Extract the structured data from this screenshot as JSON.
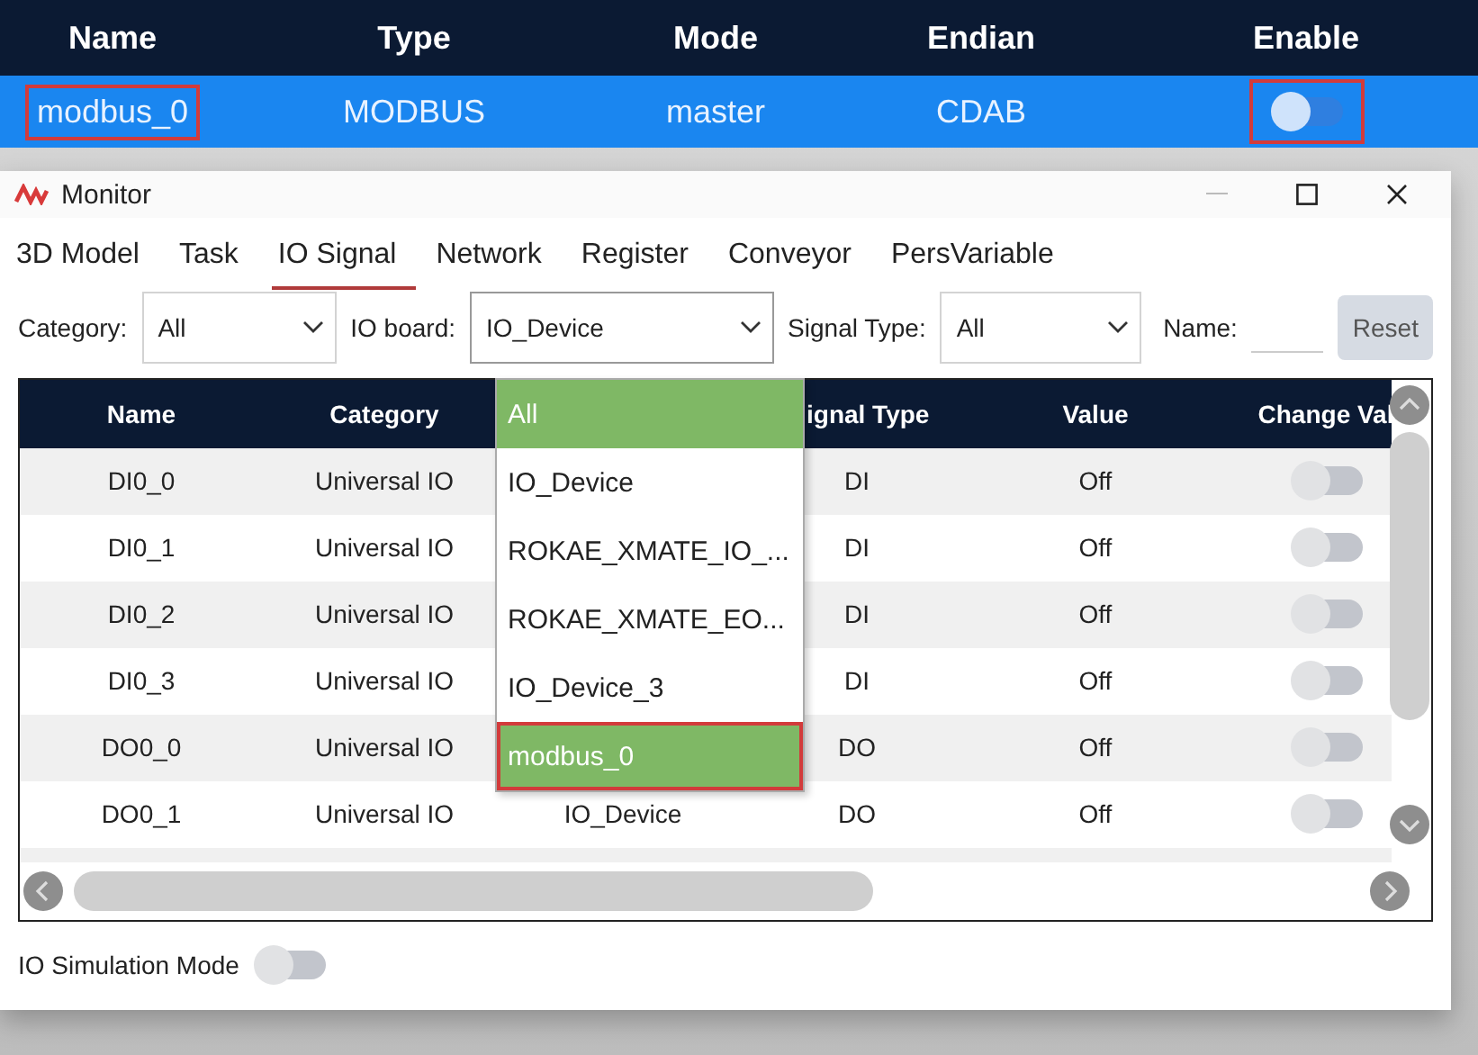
{
  "device_table": {
    "columns": [
      "Name",
      "Type",
      "Mode",
      "Endian",
      "Enable"
    ],
    "rows": [
      {
        "name": "modbus_0",
        "type": "MODBUS",
        "mode": "master",
        "endian": "CDAB",
        "enabled": false,
        "selected": true,
        "annotated": true
      }
    ]
  },
  "window": {
    "title": "Monitor"
  },
  "tabs": [
    {
      "label": "3D Model",
      "selected": false
    },
    {
      "label": "Task",
      "selected": false
    },
    {
      "label": "IO Signal",
      "selected": true
    },
    {
      "label": "Network",
      "selected": false
    },
    {
      "label": "Register",
      "selected": false
    },
    {
      "label": "Conveyor",
      "selected": false
    },
    {
      "label": "PersVariable",
      "selected": false
    }
  ],
  "filters": {
    "category": {
      "label": "Category:",
      "value": "All"
    },
    "io_board": {
      "label": "IO board:",
      "value": "IO_Device",
      "expanded": true,
      "options": [
        {
          "label": "All",
          "highlighted": true,
          "annotated": false
        },
        {
          "label": "IO_Device",
          "highlighted": false,
          "annotated": false
        },
        {
          "label": "ROKAE_XMATE_IO_...",
          "highlighted": false,
          "annotated": false
        },
        {
          "label": "ROKAE_XMATE_EO...",
          "highlighted": false,
          "annotated": false
        },
        {
          "label": "IO_Device_3",
          "highlighted": false,
          "annotated": false
        },
        {
          "label": "modbus_0",
          "highlighted": true,
          "annotated": true
        }
      ]
    },
    "signal_type": {
      "label": "Signal Type:",
      "value": "All"
    },
    "name": {
      "label": "Name:"
    },
    "reset_button": "Reset"
  },
  "signal_table": {
    "columns": [
      "Name",
      "Category",
      "",
      "ignal Type",
      "Value",
      "Change Val"
    ],
    "rows": [
      {
        "name": "DI0_0",
        "category": "Universal IO",
        "board": "",
        "signal_type": "DI",
        "value": "Off",
        "on": false
      },
      {
        "name": "DI0_1",
        "category": "Universal IO",
        "board": "",
        "signal_type": "DI",
        "value": "Off",
        "on": false
      },
      {
        "name": "DI0_2",
        "category": "Universal IO",
        "board": "",
        "signal_type": "DI",
        "value": "Off",
        "on": false
      },
      {
        "name": "DI0_3",
        "category": "Universal IO",
        "board": "",
        "signal_type": "DI",
        "value": "Off",
        "on": false
      },
      {
        "name": "DO0_0",
        "category": "Universal IO",
        "board": "",
        "signal_type": "DO",
        "value": "Off",
        "on": false
      },
      {
        "name": "DO0_1",
        "category": "Universal IO",
        "board": "IO_Device",
        "signal_type": "DO",
        "value": "Off",
        "on": false
      }
    ]
  },
  "simulation_mode": {
    "label": "IO Simulation Mode",
    "on": false
  }
}
